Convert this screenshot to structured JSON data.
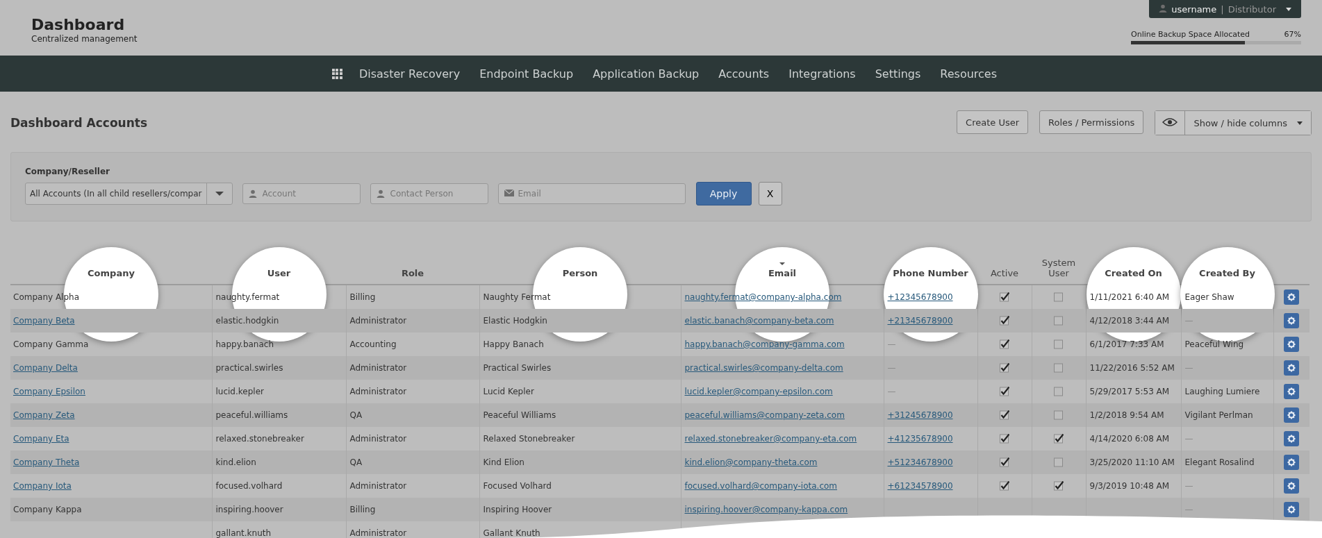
{
  "header": {
    "title": "Dashboard",
    "subtitle": "Centralized management",
    "user": {
      "name": "username",
      "separator": "|",
      "role": "Distributor"
    },
    "backup": {
      "label": "Online Backup Space Allocated",
      "reading": "67%",
      "level": 0.67
    }
  },
  "nav": [
    "Disaster Recovery",
    "Endpoint Backup",
    "Application Backup",
    "Accounts",
    "Integrations",
    "Settings",
    "Resources"
  ],
  "page_title": "Dashboard Accounts",
  "actions": [
    "Create User",
    "Roles / Permissions",
    "Show / hide columns"
  ],
  "filters": {
    "label": "Company/Reseller",
    "select_value": "All Accounts (In all child resellers/compar",
    "fields": [
      {
        "kind": "person",
        "placeholder": "Account"
      },
      {
        "kind": "person",
        "placeholder": "Contact Person"
      },
      {
        "kind": "mail",
        "placeholder": "Email"
      }
    ],
    "apply": "Apply",
    "clear": "X"
  },
  "table": {
    "columns": [
      {
        "label": "Company",
        "highlighted": true,
        "sorted": false
      },
      {
        "label": "User",
        "highlighted": true,
        "sorted": false
      },
      {
        "label": "Role",
        "highlighted": false,
        "sorted": false
      },
      {
        "label": "Person",
        "highlighted": true,
        "sorted": false
      },
      {
        "label": "Email",
        "highlighted": true,
        "sorted": true
      },
      {
        "label": "Phone Number",
        "highlighted": true,
        "sorted": false
      },
      {
        "label": "Active",
        "highlighted": false,
        "sorted": false
      },
      {
        "label": "System User",
        "highlighted": false,
        "sorted": false
      },
      {
        "label": "Created On",
        "highlighted": true,
        "sorted": false
      },
      {
        "label": "Created By",
        "highlighted": true,
        "sorted": false
      }
    ],
    "rows": [
      {
        "company": "Company Alpha",
        "company_link": false,
        "user": "naughty.fermat",
        "role": "Billing",
        "person": "Naughty Fermat",
        "email": "naughty.fermat@company-alpha.com",
        "phone": "+12345678900",
        "active": true,
        "system_user": false,
        "created_on": "1/11/2021 6:40 AM",
        "created_by": "Eager Shaw",
        "gear": true
      },
      {
        "company": "Company Beta",
        "company_link": true,
        "user": "elastic.hodgkin",
        "role": "Administrator",
        "person": "Elastic Hodgkin",
        "email": "elastic.banach@company-beta.com",
        "phone": "+21345678900",
        "active": true,
        "system_user": false,
        "created_on": "4/12/2018 3:44 AM",
        "created_by": "—",
        "gear": true
      },
      {
        "company": "Company Gamma",
        "company_link": false,
        "user": "happy.banach",
        "role": "Accounting",
        "person": "Happy Banach",
        "email": "happy.banach@company-gamma.com",
        "phone": "—",
        "active": true,
        "system_user": false,
        "created_on": "6/1/2017 7:33 AM",
        "created_by": "Peaceful Wing",
        "gear": true
      },
      {
        "company": "Company Delta",
        "company_link": true,
        "user": "practical.swirles",
        "role": "Administrator",
        "person": "Practical Swirles",
        "email": "practical.swirles@company-delta.com",
        "phone": "—",
        "active": true,
        "system_user": false,
        "created_on": "11/22/2016 5:52 AM",
        "created_by": "—",
        "gear": true
      },
      {
        "company": "Company Epsilon",
        "company_link": true,
        "user": "lucid.kepler",
        "role": "Administrator",
        "person": "Lucid Kepler",
        "email": "lucid.kepler@company-epsilon.com",
        "phone": "—",
        "active": true,
        "system_user": false,
        "created_on": "5/29/2017 5:53 AM",
        "created_by": "Laughing Lumiere",
        "gear": true
      },
      {
        "company": "Company Zeta",
        "company_link": true,
        "user": "peaceful.williams",
        "role": "QA",
        "person": "Peaceful Williams",
        "email": "peaceful.williams@company-zeta.com",
        "phone": "+31245678900",
        "active": true,
        "system_user": false,
        "created_on": "1/2/2018 9:54 AM",
        "created_by": "Vigilant Perlman",
        "gear": true
      },
      {
        "company": "Company Eta",
        "company_link": true,
        "user": "relaxed.stonebreaker",
        "role": "Administrator",
        "person": "Relaxed Stonebreaker",
        "email": "relaxed.stonebreaker@company-eta.com",
        "phone": "+41235678900",
        "active": true,
        "system_user": true,
        "created_on": "4/14/2020 6:08 AM",
        "created_by": "—",
        "gear": true
      },
      {
        "company": "Company Theta",
        "company_link": true,
        "user": "kind.elion",
        "role": "QA",
        "person": "Kind Elion",
        "email": "kind.elion@company-theta.com",
        "phone": "+51234678900",
        "active": true,
        "system_user": false,
        "created_on": "3/25/2020 11:10 AM",
        "created_by": "Elegant Rosalind",
        "gear": true
      },
      {
        "company": "Company Iota",
        "company_link": true,
        "user": "focused.volhard",
        "role": "Administrator",
        "person": "Focused Volhard",
        "email": "focused.volhard@company-iota.com",
        "phone": "+61234578900",
        "active": true,
        "system_user": true,
        "created_on": "9/3/2019 10:48 AM",
        "created_by": "—",
        "gear": true
      },
      {
        "company": "Company Kappa",
        "company_link": false,
        "user": "inspiring.hoover",
        "role": "Billing",
        "person": "Inspiring Hoover",
        "email": "inspiring.hoover@company-kappa.com",
        "created_by": "—",
        "gear": true
      },
      {
        "user": "gallant.knuth",
        "role": "Administrator",
        "person": "Gallant Knuth"
      }
    ]
  }
}
